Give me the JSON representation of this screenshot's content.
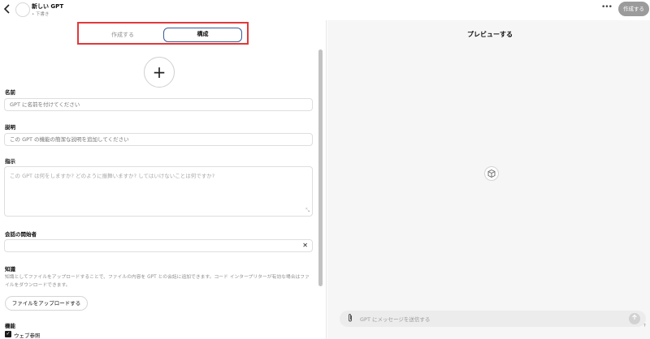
{
  "header": {
    "back_icon": "chevron-left-icon",
    "title": "新しい GPT",
    "subtitle": "• 下書き",
    "more_label": "•••",
    "create_button": "作成する"
  },
  "tabs": {
    "create": "作成する",
    "configure": "構成"
  },
  "form": {
    "add_image_label": "+",
    "name_label": "名前",
    "name_placeholder": "GPT に名前を付けてください",
    "description_label": "説明",
    "description_placeholder": "この GPT の機能の簡潔な説明を追加してください",
    "instructions_label": "指示",
    "instructions_placeholder": "この GPT は何をしますか? どのように振舞いますか? してはいけないことは何ですか?",
    "conversation_starters_label": "会話の開始者",
    "conversation_starter_value": "",
    "clear_label": "✕",
    "knowledge_label": "知識",
    "knowledge_description": "知識としてファイルをアップロードすることで、ファイルの内容を GPT との会話に追加できます。コード インタープリターが有効な場合はファイルをダウンロードできます。",
    "upload_button": "ファイルをアップロードする",
    "capabilities_label": "機能",
    "capability_web": "ウェブ参照",
    "capability_web_checked": true
  },
  "preview": {
    "title": "プレビューする",
    "center_icon": "cube-icon",
    "chat_placeholder": "GPT にメッセージを送信する",
    "attach_icon": "paperclip-icon",
    "send_icon": "arrow-up-icon",
    "help_label": "?"
  },
  "colors": {
    "highlight_border": "#e0393b",
    "active_tab_border": "#3b5b9a",
    "create_button_bg": "#9b9b9b",
    "preview_bg": "#f6f6f6"
  }
}
